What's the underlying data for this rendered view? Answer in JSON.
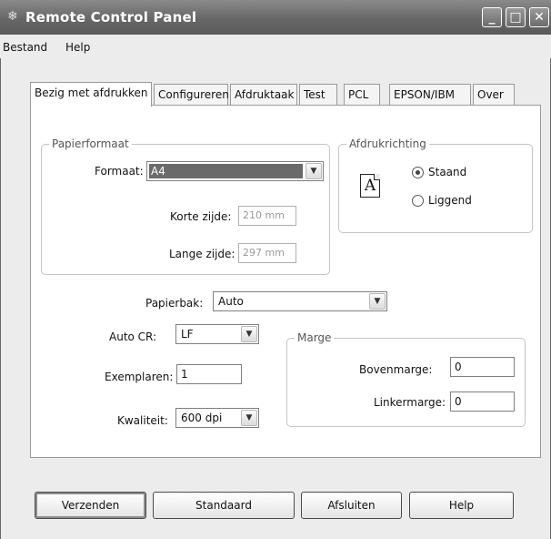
{
  "window": {
    "title": "Remote Control Panel",
    "icon": "printer-icon",
    "minimize": "_",
    "maximize": "□",
    "close": "✕"
  },
  "menu": {
    "items": [
      "Bestand",
      "Help"
    ]
  },
  "tabs": [
    "Bezig met afdrukken",
    "Configureren",
    "Afdruktaak",
    "Test",
    "PCL",
    "EPSON/IBM",
    "Over"
  ],
  "papier": {
    "group_label": "Papierformaat",
    "formaat_label": "Formaat:",
    "formaat_value": "A4",
    "korte_label": "Korte zijde:",
    "korte_value": "210 mm",
    "lange_label": "Lange zijde:",
    "lange_value": "297 mm"
  },
  "richting": {
    "group_label": "Afdrukrichting",
    "icon_letter": "A",
    "staand": "Staand",
    "liggend": "Liggend",
    "selected": "Staand"
  },
  "papierbak": {
    "label": "Papierbak:",
    "value": "Auto"
  },
  "autocr": {
    "label": "Auto CR:",
    "value": "LF"
  },
  "exemplaren": {
    "label": "Exemplaren:",
    "value": "1"
  },
  "kwaliteit": {
    "label": "Kwaliteit:",
    "value": "600 dpi"
  },
  "marge": {
    "group_label": "Marge",
    "boven_label": "Bovenmarge:",
    "boven_value": "0",
    "linker_label": "Linkermarge:",
    "linker_value": "0"
  },
  "buttons": {
    "verzenden": "Verzenden",
    "standaard": "Standaard",
    "afsluiten": "Afsluiten",
    "help": "Help"
  }
}
